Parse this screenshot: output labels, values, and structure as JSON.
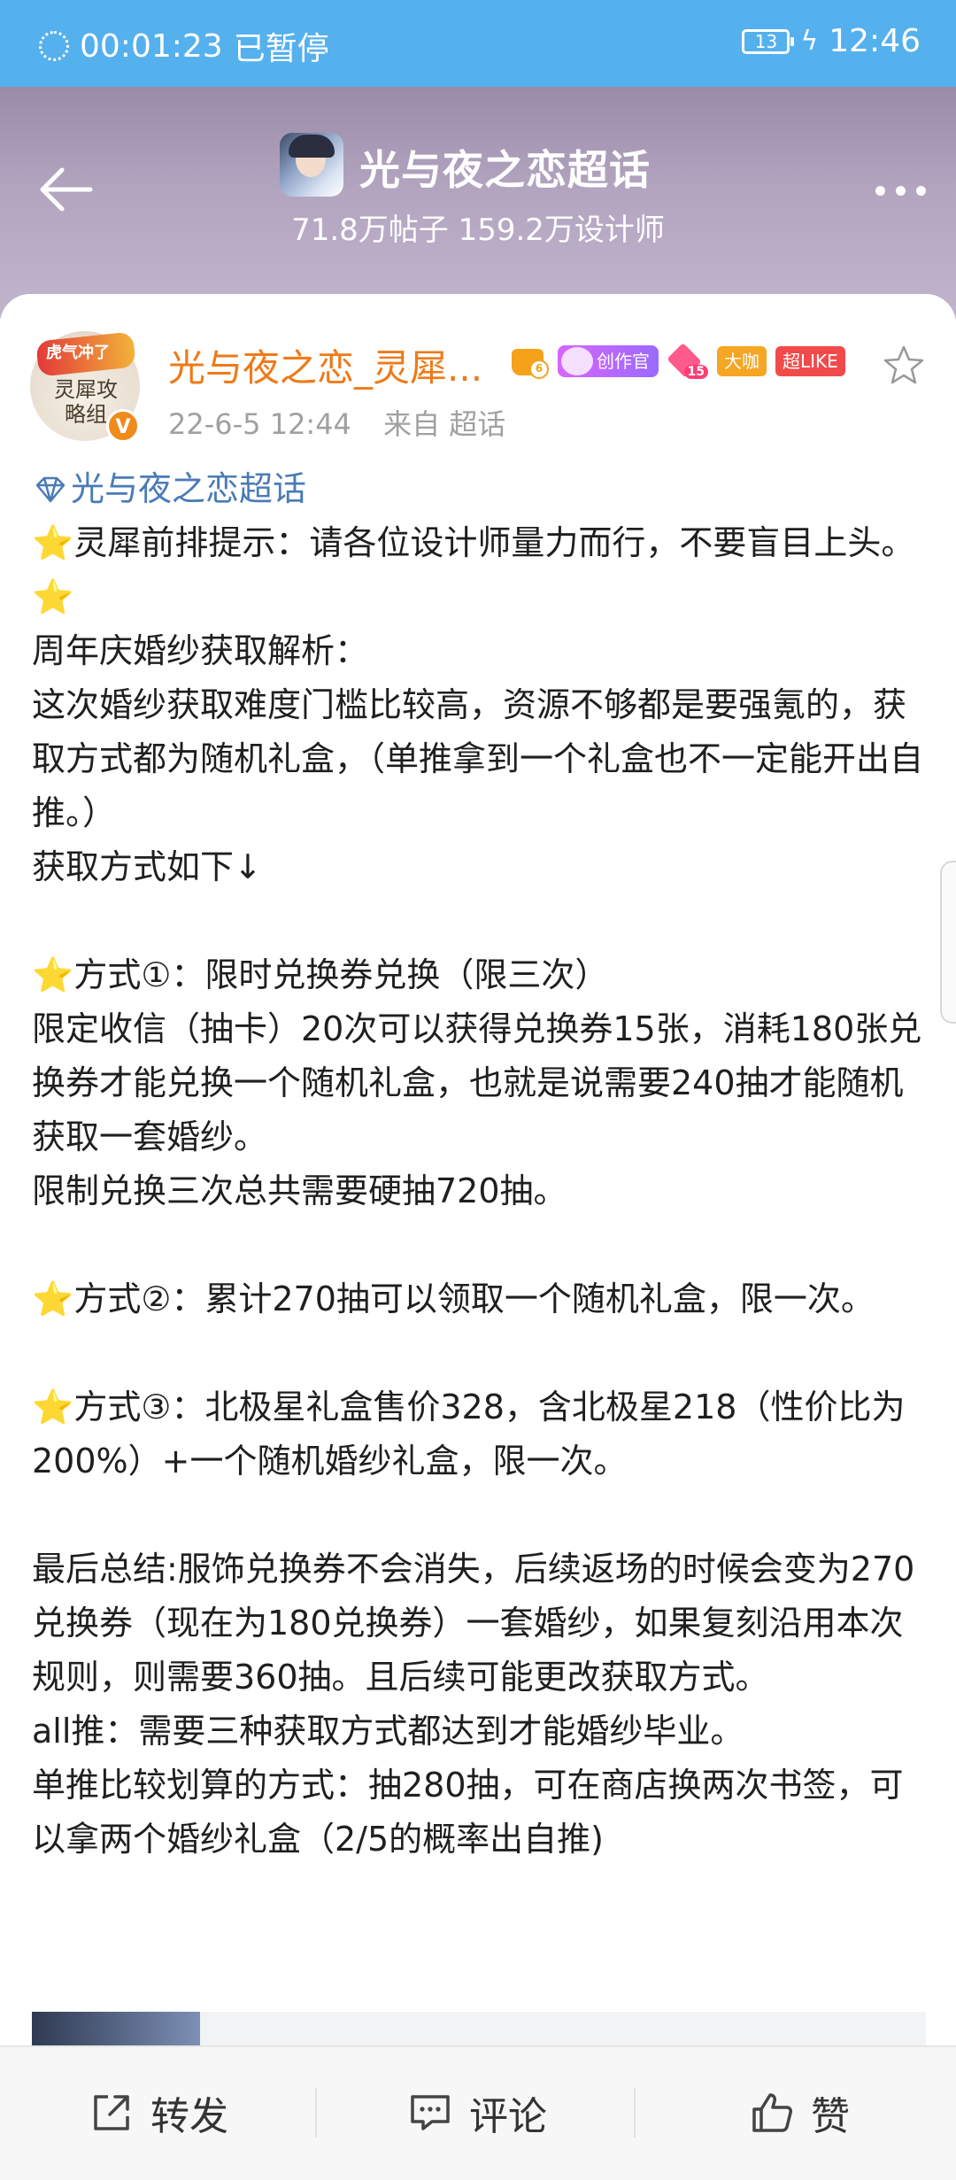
{
  "status_bar": {
    "timer": "00:01:23",
    "state": "已暂停",
    "battery": "13",
    "time": "12:46"
  },
  "header": {
    "title": "光与夜之恋超话",
    "posts": "71.8万帖子",
    "designers": "159.2万设计师"
  },
  "post": {
    "author": "光与夜之恋_灵犀...",
    "avatar_top_text": "虎气冲了",
    "avatar_text": "灵犀攻略组",
    "verified": "V",
    "badges": {
      "crown_level": "6",
      "creator": "创作官",
      "level": "15",
      "dk": "大咖",
      "like": "超LIKE"
    },
    "date": "22-6-5 12:44",
    "source": "来自 超话",
    "topic_link": "光与夜之恋超话",
    "lines": [
      "⭐灵犀前排提示：请各位设计师量力而行，不要盲目上头。⭐",
      "周年庆婚纱获取解析：",
      "这次婚纱获取难度门槛比较高，资源不够都是要强氪的，获取方式都为随机礼盒，（单推拿到一个礼盒也不一定能开出自推。）",
      "获取方式如下↓",
      "",
      "⭐方式①：限时兑换券兑换（限三次）",
      "限定收信（抽卡）20次可以获得兑换券15张，消耗180张兑换券才能兑换一个随机礼盒，也就是说需要240抽才能随机获取一套婚纱。",
      "限制兑换三次总共需要硬抽720抽。",
      "",
      "⭐方式②：累计270抽可以领取一个随机礼盒，限一次。",
      "",
      "⭐方式③：北极星礼盒售价328，含北极星218（性价比为200%）+一个随机婚纱礼盒，限一次。",
      "",
      "最后总结:服饰兑换券不会消失，后续返场的时候会变为270兑换券（现在为180兑换券）一套婚纱，如果复刻沿用本次规则，则需要360抽。且后续可能更改获取方式。",
      "all推：需要三种获取方式都达到才能婚纱毕业。",
      "单推比较划算的方式：抽280抽，可在商店换两次书签，可以拿两个婚纱礼盒（2/5的概率出自推)"
    ]
  },
  "bottom_bar": {
    "repost": "转发",
    "comment": "评论",
    "like": "赞"
  },
  "colors": {
    "status_bar": "#55b0ee",
    "username": "#ee7a18",
    "topic_link": "#4a7bb7",
    "star": "#f6a71c"
  }
}
